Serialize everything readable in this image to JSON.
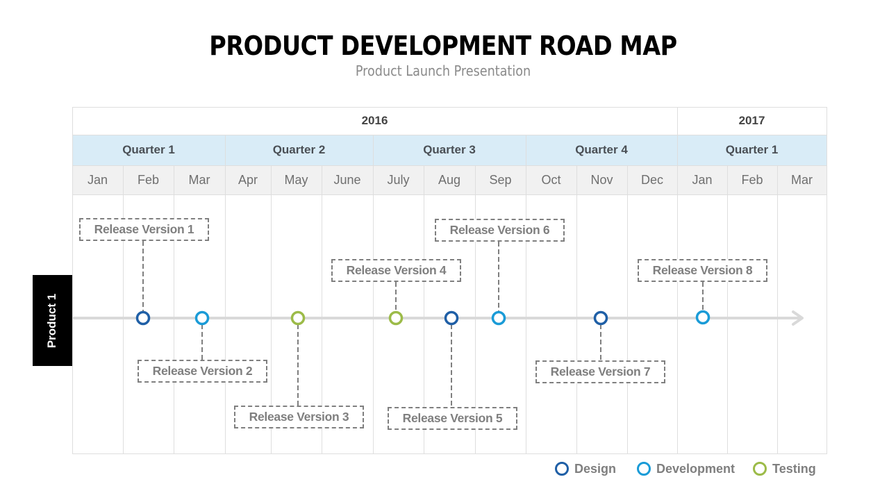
{
  "header": {
    "title": "PRODUCT DEVELOPMENT ROAD MAP",
    "subtitle": "Product Launch Presentation"
  },
  "colors": {
    "design": "#1f5fa6",
    "development": "#1a9bd7",
    "testing": "#9cbb48",
    "quarter_bg": "#d9ecf7",
    "month_bg": "#f1f1f1",
    "callout_border": "#7f7f7f",
    "timeline": "#d9d9d9"
  },
  "years": [
    {
      "label": "2016"
    },
    {
      "label": "2017"
    }
  ],
  "quarters": [
    {
      "label": "Quarter 1"
    },
    {
      "label": "Quarter 2"
    },
    {
      "label": "Quarter 3"
    },
    {
      "label": "Quarter 4"
    },
    {
      "label": "Quarter 1"
    }
  ],
  "months": [
    "Jan",
    "Feb",
    "Mar",
    "Apr",
    "May",
    "June",
    "July",
    "Aug",
    "Sep",
    "Oct",
    "Nov",
    "Dec",
    "Jan",
    "Feb",
    "Mar"
  ],
  "product": {
    "label": "Product 1"
  },
  "milestones": [
    {
      "label": "Release Version 1",
      "type": "design",
      "month_position": 1.4,
      "callout": "above"
    },
    {
      "label": "Release Version 2",
      "type": "development",
      "month_position": 2.6,
      "callout": "below"
    },
    {
      "label": "Release Version 3",
      "type": "testing",
      "month_position": 4.5,
      "callout": "below"
    },
    {
      "label": "Release Version 4",
      "type": "testing",
      "month_position": 6.45,
      "callout": "above"
    },
    {
      "label": "Release Version 5",
      "type": "design",
      "month_position": 7.55,
      "callout": "below"
    },
    {
      "label": "Release Version 6",
      "type": "development",
      "month_position": 8.45,
      "callout": "above"
    },
    {
      "label": "Release Version 7",
      "type": "design",
      "month_position": 10.5,
      "callout": "below"
    },
    {
      "label": "Release Version 8",
      "type": "development",
      "month_position": 12.5,
      "callout": "above"
    }
  ],
  "legend": [
    {
      "key": "design",
      "label": "Design"
    },
    {
      "key": "development",
      "label": "Development"
    },
    {
      "key": "testing",
      "label": "Testing"
    }
  ]
}
